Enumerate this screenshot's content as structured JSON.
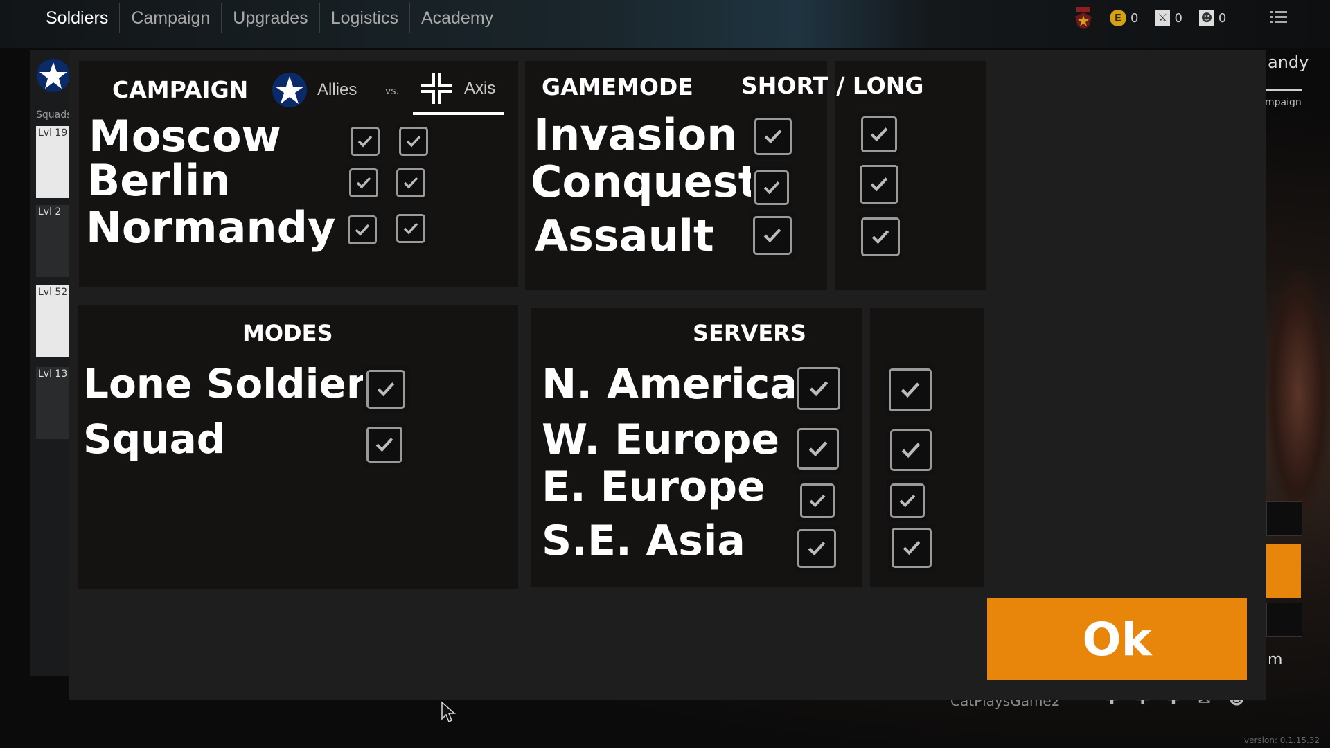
{
  "nav": {
    "tabs": [
      "Soldiers",
      "Campaign",
      "Upgrades",
      "Logistics",
      "Academy"
    ],
    "active": "Soldiers"
  },
  "currencies": [
    {
      "icon": "e-coin-icon",
      "label": "E",
      "value": "0"
    },
    {
      "icon": "crossed-swords-icon",
      "label": "⚔",
      "value": "0"
    },
    {
      "icon": "soldier-portrait-icon",
      "label": "☻",
      "value": "0"
    }
  ],
  "sidebar": {
    "squads_label": "Squads",
    "squads": [
      {
        "level": "Lvl 19"
      },
      {
        "level": "Lvl 2"
      },
      {
        "level": "Lvl 52"
      },
      {
        "level": "Lvl 13"
      }
    ]
  },
  "background": {
    "right_title": "andy",
    "right_sub": "mpaign",
    "right_m": "m",
    "version": "version: 0.1.15.32",
    "user": "CatPlaysGame2"
  },
  "campaign": {
    "title": "CAMPAIGN",
    "allies_label": "Allies",
    "vs_label": "vs.",
    "axis_label": "Axis",
    "rows": [
      {
        "name": "Moscow",
        "allies": true,
        "axis": true
      },
      {
        "name": "Berlin",
        "allies": true,
        "axis": true
      },
      {
        "name": "Normandy",
        "allies": true,
        "axis": true
      }
    ]
  },
  "gamemode": {
    "title": "GAMEMODE",
    "length_title": "SHORT / LONG",
    "rows": [
      {
        "name": "Invasion",
        "short": true,
        "long": true
      },
      {
        "name": "Conquest",
        "short": true,
        "long": true
      },
      {
        "name": "Assault",
        "short": true,
        "long": true
      }
    ]
  },
  "modes": {
    "title": "MODES",
    "rows": [
      {
        "name": "Lone Soldier",
        "checked": true
      },
      {
        "name": "Squad",
        "checked": true
      }
    ]
  },
  "servers": {
    "title": "SERVERS",
    "rows": [
      {
        "name": "N. America",
        "col1": true,
        "col2": true
      },
      {
        "name": "W. Europe",
        "col1": true,
        "col2": true
      },
      {
        "name": "E. Europe",
        "col1": true,
        "col2": true
      },
      {
        "name": "S.E. Asia",
        "col1": true,
        "col2": true
      }
    ]
  },
  "ok_label": "Ok",
  "colors": {
    "accent": "#e8850b",
    "panel": "#141312",
    "dialog": "#1e1e1e"
  }
}
